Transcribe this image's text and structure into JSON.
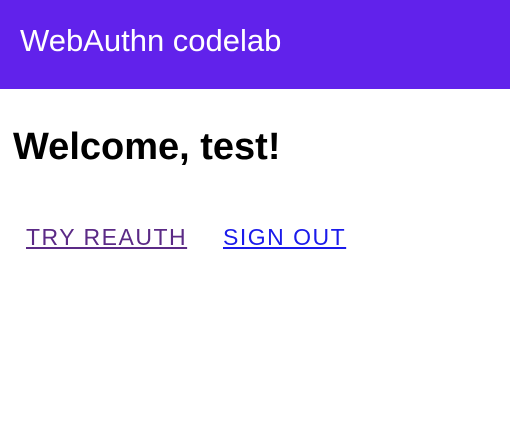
{
  "appbar": {
    "title": "WebAuthn codelab",
    "color": "#6122eb"
  },
  "main": {
    "heading": "Welcome, test!",
    "links": {
      "try_reauth": "TRY REAUTH",
      "sign_out": "SIGN OUT"
    }
  }
}
